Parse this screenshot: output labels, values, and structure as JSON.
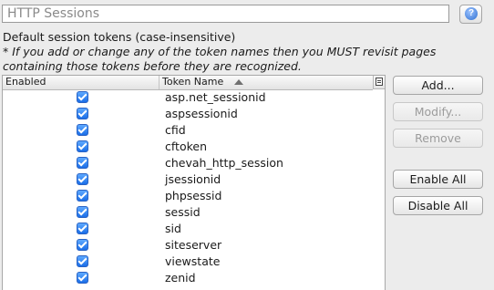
{
  "panel": {
    "title": "HTTP Sessions",
    "help_symbol": "?",
    "heading": "Default session tokens (case-insensitive)",
    "note_line1": "* If you add or change any of the token names then you MUST revisit pages",
    "note_line2": "containing those tokens before they are recognized."
  },
  "table": {
    "columns": [
      "Enabled",
      "Token Name"
    ],
    "sort_column": "Token Name",
    "sort_direction": "ascending",
    "rows": [
      {
        "enabled": true,
        "name": "asp.net_sessionid"
      },
      {
        "enabled": true,
        "name": "aspsessionid"
      },
      {
        "enabled": true,
        "name": "cfid"
      },
      {
        "enabled": true,
        "name": "cftoken"
      },
      {
        "enabled": true,
        "name": "chevah_http_session"
      },
      {
        "enabled": true,
        "name": "jsessionid"
      },
      {
        "enabled": true,
        "name": "phpsessid"
      },
      {
        "enabled": true,
        "name": "sessid"
      },
      {
        "enabled": true,
        "name": "sid"
      },
      {
        "enabled": true,
        "name": "siteserver"
      },
      {
        "enabled": true,
        "name": "viewstate"
      },
      {
        "enabled": true,
        "name": "zenid"
      }
    ]
  },
  "buttons": {
    "add": "Add...",
    "modify": "Modify...",
    "remove": "Remove",
    "enable_all": "Enable All",
    "disable_all": "Disable All"
  },
  "colors": {
    "checkbox": "#1a6ee8",
    "background": "#ececec"
  }
}
